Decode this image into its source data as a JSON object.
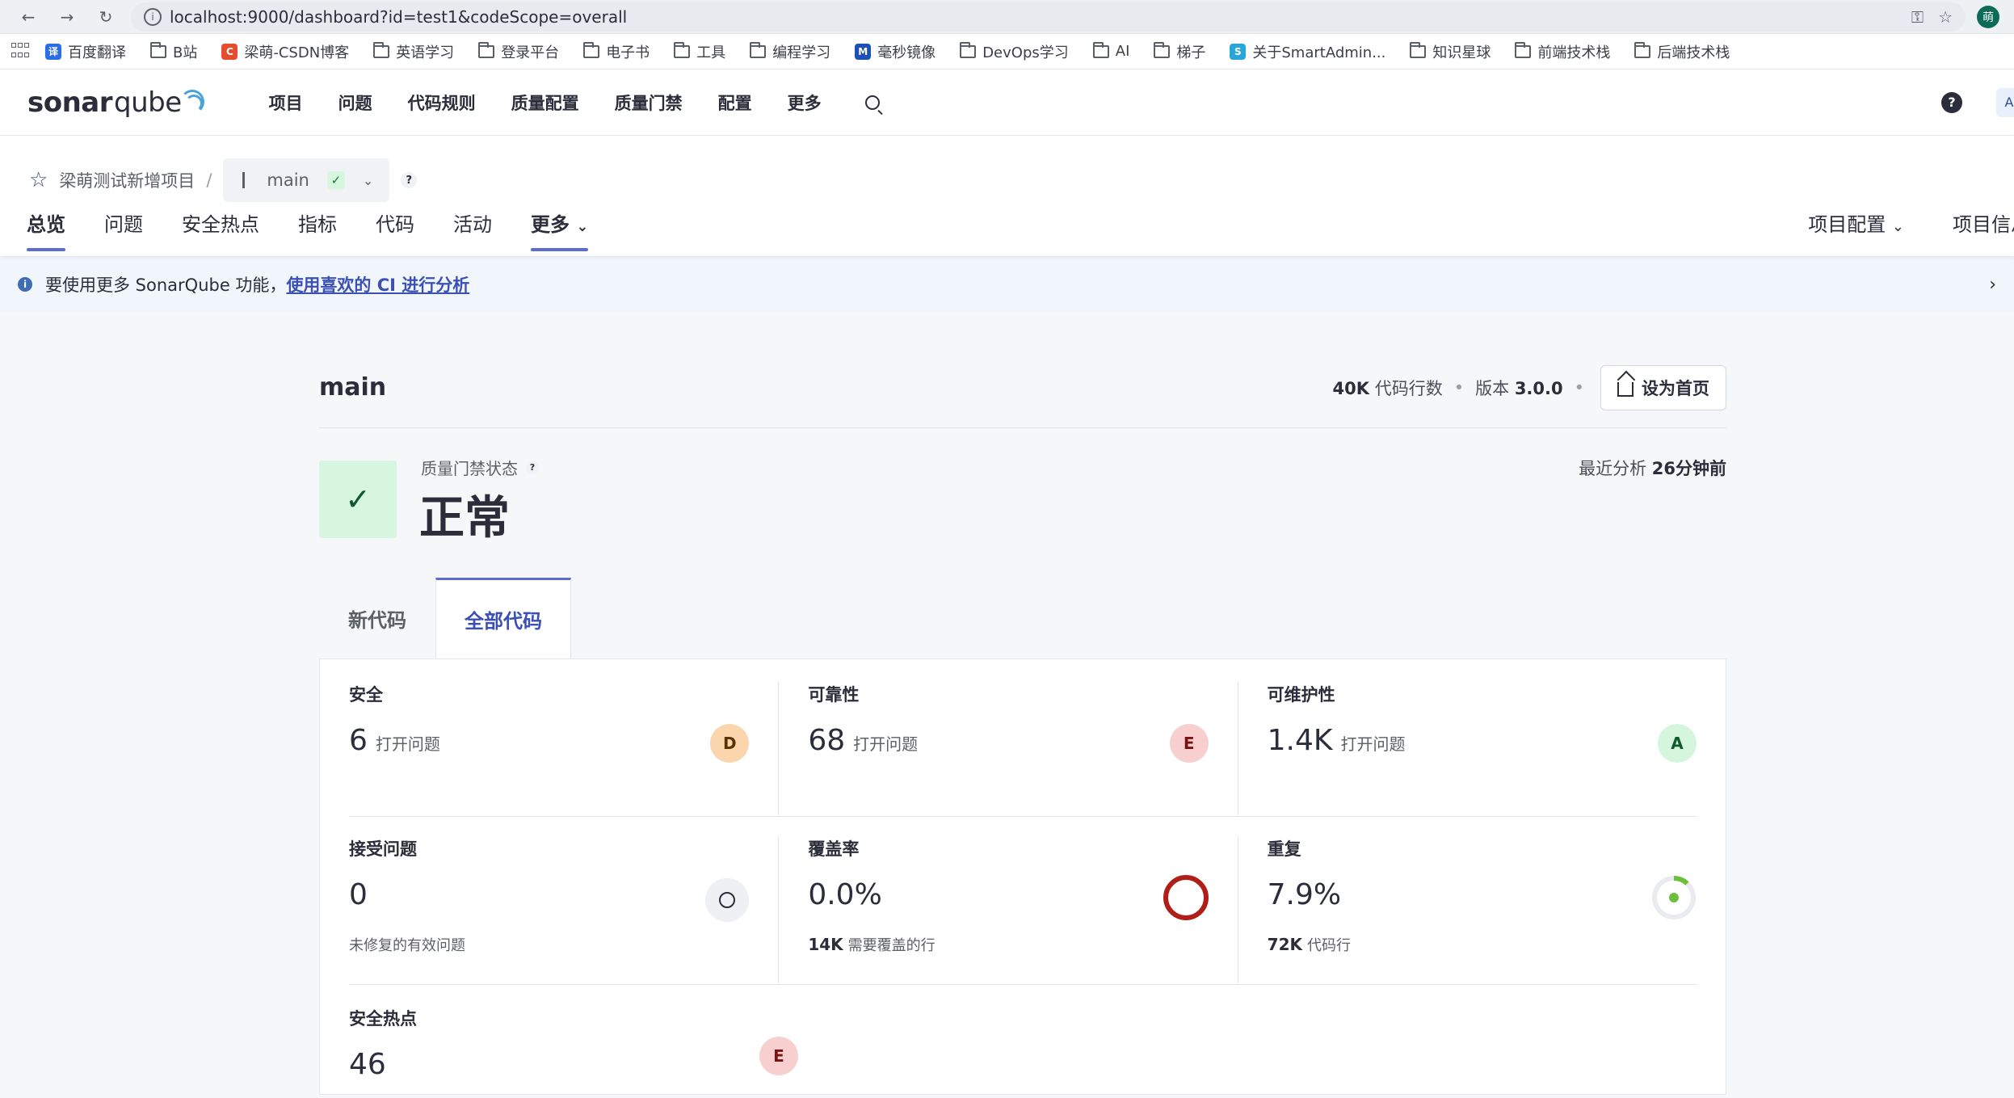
{
  "browser": {
    "url": "localhost:9000/dashboard?id=test1&codeScope=overall",
    "profile_initial": "萌"
  },
  "bookmarks": [
    {
      "label": "百度翻译",
      "icon": "translate-icon",
      "color": "#2b6de5"
    },
    {
      "label": "B站",
      "icon": "folder-icon"
    },
    {
      "label": "梁萌-CSDN博客",
      "icon": "csdn-icon",
      "color": "#e54d2e"
    },
    {
      "label": "英语学习",
      "icon": "folder-icon"
    },
    {
      "label": "登录平台",
      "icon": "folder-icon"
    },
    {
      "label": "电子书",
      "icon": "folder-icon"
    },
    {
      "label": "工具",
      "icon": "folder-icon"
    },
    {
      "label": "编程学习",
      "icon": "folder-icon"
    },
    {
      "label": "毫秒镜像",
      "icon": "mirror-icon",
      "color": "#1e4fb8"
    },
    {
      "label": "DevOps学习",
      "icon": "folder-icon"
    },
    {
      "label": "AI",
      "icon": "folder-icon"
    },
    {
      "label": "梯子",
      "icon": "folder-icon"
    },
    {
      "label": "关于SmartAdmin...",
      "icon": "smartadmin-icon",
      "color": "#2aa7d8"
    },
    {
      "label": "知识星球",
      "icon": "folder-icon"
    },
    {
      "label": "前端技术栈",
      "icon": "folder-icon"
    },
    {
      "label": "后端技术栈",
      "icon": "folder-icon"
    }
  ],
  "header": {
    "logo_main": "sonar",
    "logo_sub": "qube",
    "nav": [
      "项目",
      "问题",
      "代码规则",
      "质量配置",
      "质量门禁",
      "配置",
      "更多"
    ],
    "avatar": "A"
  },
  "project": {
    "name": "梁萌测试新增项目",
    "separator": "/",
    "branch": "main",
    "tabs": [
      "总览",
      "问题",
      "安全热点",
      "指标",
      "代码",
      "活动",
      "更多"
    ],
    "right_tabs": [
      "项目配置",
      "项目信息"
    ]
  },
  "banner": {
    "text": "要使用更多 SonarQube 功能，",
    "link": "使用喜欢的 CI 进行分析"
  },
  "main": {
    "branch_title": "main",
    "loc_value": "40K",
    "loc_label": "代码行数",
    "version_label": "版本",
    "version_value": "3.0.0",
    "home_button": "设为首页",
    "qg_label": "质量门禁状态",
    "qg_status": "正常",
    "last_analysis_label": "最近分析",
    "last_analysis_value": "26分钟前",
    "code_tabs": [
      "新代码",
      "全部代码"
    ]
  },
  "metrics": {
    "security": {
      "title": "安全",
      "value": "6",
      "unit": "打开问题",
      "rating": "D"
    },
    "reliability": {
      "title": "可靠性",
      "value": "68",
      "unit": "打开问题",
      "rating": "E"
    },
    "maintainability": {
      "title": "可维护性",
      "value": "1.4K",
      "unit": "打开问题",
      "rating": "A"
    },
    "accepted": {
      "title": "接受问题",
      "value": "0",
      "sub": "未修复的有效问题"
    },
    "coverage": {
      "title": "覆盖率",
      "value": "0.0%",
      "sub_value": "14K",
      "sub": "需要覆盖的行"
    },
    "duplication": {
      "title": "重复",
      "value": "7.9%",
      "sub_value": "72K",
      "sub": "代码行",
      "fraction": 0.079
    },
    "hotspots": {
      "title": "安全热点",
      "value": "46",
      "rating": "E"
    }
  },
  "colors": {
    "accent": "#5d6cd0",
    "pass_bg": "#d6f6df",
    "coverage_ring": "#b01f17",
    "dup_ring": "#6bbf3b"
  }
}
